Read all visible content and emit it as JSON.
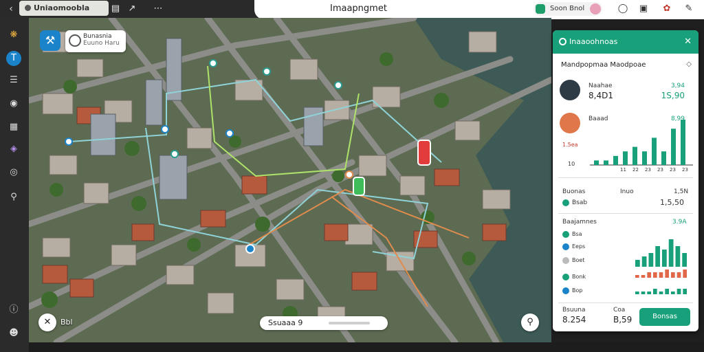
{
  "topbar": {
    "back_icon": "chevron-left-icon",
    "app_tab_label": "Uniaomoobla",
    "title": "Imaapngmet",
    "status_label": "Soon Bnol",
    "status_color": "#1e9e6a",
    "icons": [
      "layout-icon",
      "cursor-icon",
      "location-pin-icon",
      "calendar-icon",
      "palette-icon",
      "bell-icon"
    ]
  },
  "sidebar": {
    "icons": [
      "apps-icon",
      "text-icon",
      "layers-icon",
      "circle-icon",
      "chart-icon",
      "shield-icon",
      "compass-icon",
      "search-icon",
      "info-icon",
      "users-icon"
    ],
    "active": 1,
    "accent": "#1a83c9"
  },
  "map": {
    "location_card": {
      "title": "Bunasnia",
      "subtitle": "Euuno Haru"
    },
    "corner_label": "Bbl",
    "search_text": "Ssuaaa 9",
    "route_colors": [
      "#8fd3d8",
      "#aee36a",
      "#e08c4c"
    ]
  },
  "panel": {
    "header_title": "Inaaoohnoas",
    "section_title": "Mandpopmaa Maodpoae",
    "accent": "#18a07a",
    "rows": [
      {
        "key": "Naahae",
        "value": "8,4D1",
        "right_top": "3,94",
        "right_value": "1S,90"
      },
      {
        "key": "Baaad",
        "value": "",
        "right_top": "8,99",
        "right_value": ""
      }
    ],
    "chart_y_labels": [
      "1.5ea",
      "10",
      "0"
    ],
    "chart_x_labels": [
      "11",
      "22",
      "23",
      "23",
      "23",
      "23"
    ],
    "summary": {
      "left_label": "Buonas",
      "mid_label": "Inuo",
      "right_label": "1,5N",
      "left_value": "Bsab",
      "right_value": "1,5,50"
    },
    "list_title": "Baajamnes",
    "list_value": "3.9A",
    "list_items": [
      "Bsa",
      "Eeps",
      "Boet",
      "Bonk",
      "Bop"
    ],
    "footer": {
      "label1": "Bsuuna",
      "value1": "8.254",
      "label2": "Coa",
      "value2": "B,59",
      "button_label": "Bonsas"
    }
  },
  "chart_data": [
    {
      "type": "bar",
      "values": [
        1,
        1,
        2,
        3,
        4,
        3,
        6,
        3,
        8,
        10
      ],
      "ylim": [
        0,
        10
      ]
    },
    {
      "type": "bar",
      "series": [
        {
          "values": [
            2,
            3,
            4,
            6,
            5,
            8,
            6,
            4
          ]
        },
        {
          "values": [
            1,
            1,
            2,
            2,
            2,
            3,
            2,
            2,
            3
          ]
        },
        {
          "values": [
            1,
            1,
            1,
            2,
            1,
            2,
            1,
            2,
            2
          ]
        },
        {
          "values": [
            1,
            1,
            1,
            1,
            2,
            2,
            1,
            1
          ]
        }
      ]
    }
  ]
}
